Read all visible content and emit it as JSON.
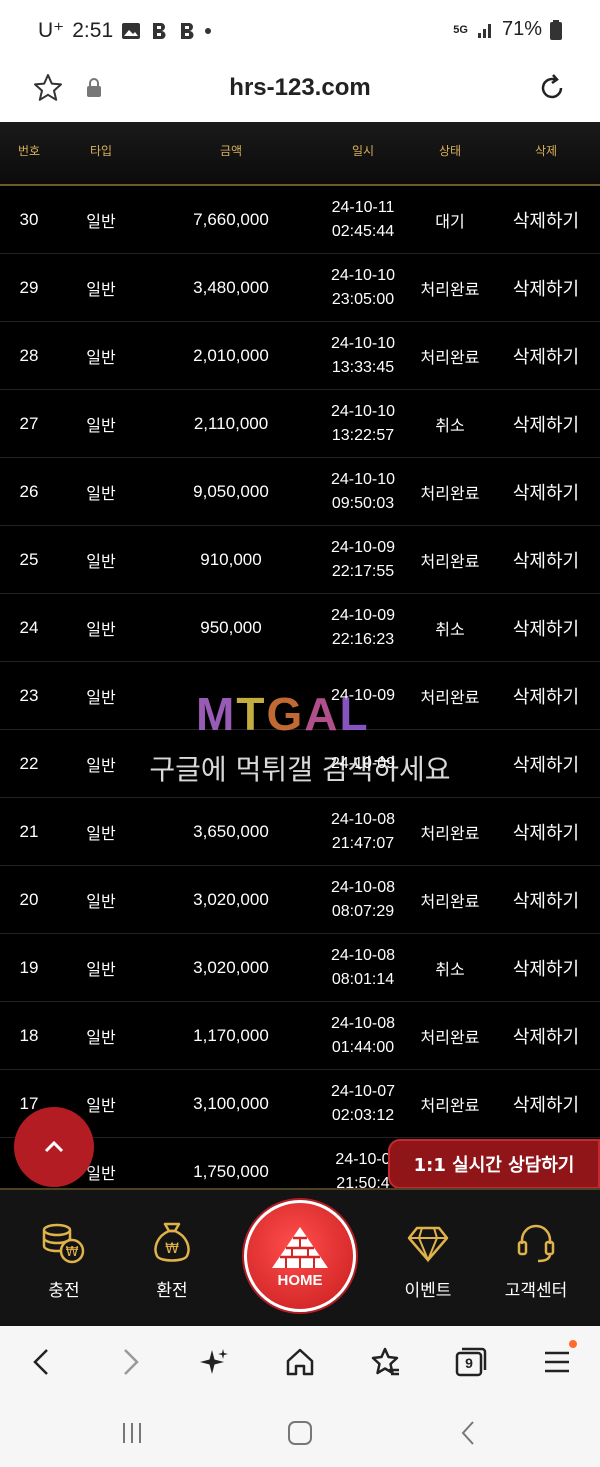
{
  "status_bar": {
    "carrier": "U⁺",
    "time": "2:51",
    "network": "5G",
    "battery": "71%"
  },
  "browser": {
    "url": "hrs-123.com"
  },
  "table": {
    "headers": [
      "번호",
      "타입",
      "금액",
      "일시",
      "상태",
      "삭제"
    ],
    "rows": [
      {
        "no": "30",
        "type": "일반",
        "amount": "7,660,000",
        "date": "24-10-11",
        "time": "02:45:44",
        "status": "대기",
        "action": "삭제하기"
      },
      {
        "no": "29",
        "type": "일반",
        "amount": "3,480,000",
        "date": "24-10-10",
        "time": "23:05:00",
        "status": "처리완료",
        "action": "삭제하기"
      },
      {
        "no": "28",
        "type": "일반",
        "amount": "2,010,000",
        "date": "24-10-10",
        "time": "13:33:45",
        "status": "처리완료",
        "action": "삭제하기"
      },
      {
        "no": "27",
        "type": "일반",
        "amount": "2,110,000",
        "date": "24-10-10",
        "time": "13:22:57",
        "status": "취소",
        "action": "삭제하기"
      },
      {
        "no": "26",
        "type": "일반",
        "amount": "9,050,000",
        "date": "24-10-10",
        "time": "09:50:03",
        "status": "처리완료",
        "action": "삭제하기"
      },
      {
        "no": "25",
        "type": "일반",
        "amount": "910,000",
        "date": "24-10-09",
        "time": "22:17:55",
        "status": "처리완료",
        "action": "삭제하기"
      },
      {
        "no": "24",
        "type": "일반",
        "amount": "950,000",
        "date": "24-10-09",
        "time": "22:16:23",
        "status": "취소",
        "action": "삭제하기"
      },
      {
        "no": "23",
        "type": "일반",
        "amount": "",
        "date": "24-10-09",
        "time": "",
        "status": "처리완료",
        "action": "삭제하기"
      },
      {
        "no": "22",
        "type": "일반",
        "amount": "",
        "date": "24-10-09",
        "time": "",
        "status": "",
        "action": "삭제하기"
      },
      {
        "no": "21",
        "type": "일반",
        "amount": "3,650,000",
        "date": "24-10-08",
        "time": "21:47:07",
        "status": "처리완료",
        "action": "삭제하기"
      },
      {
        "no": "20",
        "type": "일반",
        "amount": "3,020,000",
        "date": "24-10-08",
        "time": "08:07:29",
        "status": "처리완료",
        "action": "삭제하기"
      },
      {
        "no": "19",
        "type": "일반",
        "amount": "3,020,000",
        "date": "24-10-08",
        "time": "08:01:14",
        "status": "취소",
        "action": "삭제하기"
      },
      {
        "no": "18",
        "type": "일반",
        "amount": "1,170,000",
        "date": "24-10-08",
        "time": "01:44:00",
        "status": "처리완료",
        "action": "삭제하기"
      },
      {
        "no": "17",
        "type": "일반",
        "amount": "3,100,000",
        "date": "24-10-07",
        "time": "02:03:12",
        "status": "처리완료",
        "action": "삭제하기"
      },
      {
        "no": "",
        "type": "일반",
        "amount": "1,750,000",
        "date": "24-10-0",
        "time": "21:50:4",
        "status": "",
        "action": ""
      }
    ]
  },
  "watermark": {
    "logo": "MTGAL",
    "text": "구글에 먹튀갤 검색하세요"
  },
  "chat_button": "1:1 실시간 상담하기",
  "bottom_nav": {
    "charge": "충전",
    "exchange": "환전",
    "home": "HOME",
    "event": "이벤트",
    "support": "고객센터"
  },
  "browser_toolbar": {
    "tab_count": "9"
  },
  "colors": {
    "accent_gold": "#d7b05a",
    "accent_red": "#b31c22"
  }
}
